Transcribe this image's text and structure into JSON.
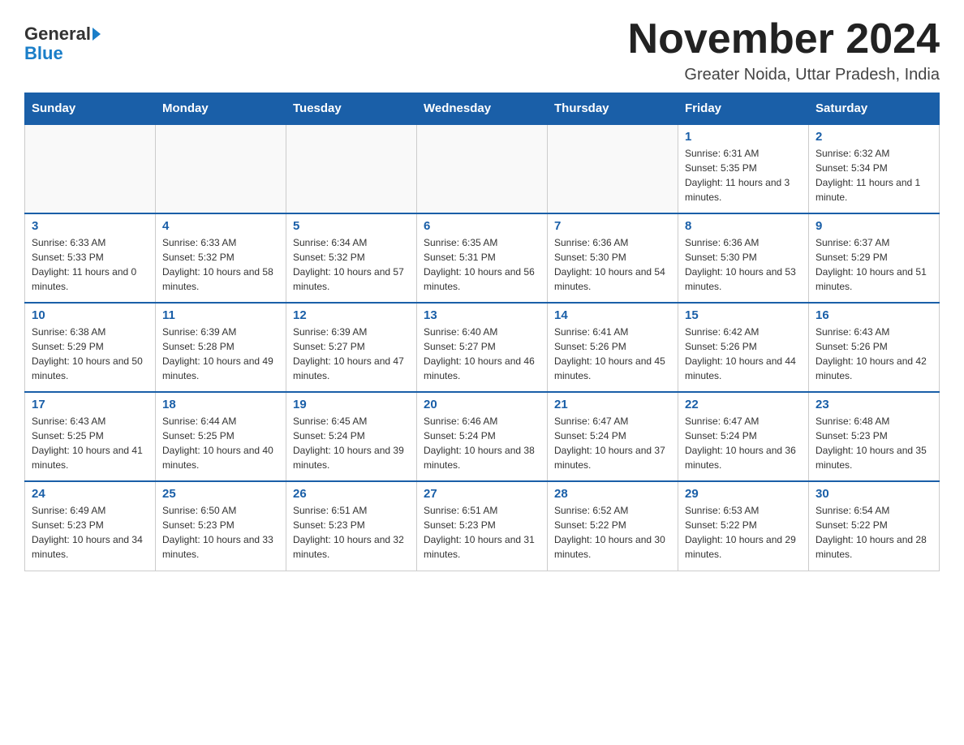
{
  "logo": {
    "general": "General",
    "blue": "Blue"
  },
  "title": "November 2024",
  "location": "Greater Noida, Uttar Pradesh, India",
  "days_of_week": [
    "Sunday",
    "Monday",
    "Tuesday",
    "Wednesday",
    "Thursday",
    "Friday",
    "Saturday"
  ],
  "weeks": [
    [
      {
        "day": "",
        "info": ""
      },
      {
        "day": "",
        "info": ""
      },
      {
        "day": "",
        "info": ""
      },
      {
        "day": "",
        "info": ""
      },
      {
        "day": "",
        "info": ""
      },
      {
        "day": "1",
        "info": "Sunrise: 6:31 AM\nSunset: 5:35 PM\nDaylight: 11 hours and 3 minutes."
      },
      {
        "day": "2",
        "info": "Sunrise: 6:32 AM\nSunset: 5:34 PM\nDaylight: 11 hours and 1 minute."
      }
    ],
    [
      {
        "day": "3",
        "info": "Sunrise: 6:33 AM\nSunset: 5:33 PM\nDaylight: 11 hours and 0 minutes."
      },
      {
        "day": "4",
        "info": "Sunrise: 6:33 AM\nSunset: 5:32 PM\nDaylight: 10 hours and 58 minutes."
      },
      {
        "day": "5",
        "info": "Sunrise: 6:34 AM\nSunset: 5:32 PM\nDaylight: 10 hours and 57 minutes."
      },
      {
        "day": "6",
        "info": "Sunrise: 6:35 AM\nSunset: 5:31 PM\nDaylight: 10 hours and 56 minutes."
      },
      {
        "day": "7",
        "info": "Sunrise: 6:36 AM\nSunset: 5:30 PM\nDaylight: 10 hours and 54 minutes."
      },
      {
        "day": "8",
        "info": "Sunrise: 6:36 AM\nSunset: 5:30 PM\nDaylight: 10 hours and 53 minutes."
      },
      {
        "day": "9",
        "info": "Sunrise: 6:37 AM\nSunset: 5:29 PM\nDaylight: 10 hours and 51 minutes."
      }
    ],
    [
      {
        "day": "10",
        "info": "Sunrise: 6:38 AM\nSunset: 5:29 PM\nDaylight: 10 hours and 50 minutes."
      },
      {
        "day": "11",
        "info": "Sunrise: 6:39 AM\nSunset: 5:28 PM\nDaylight: 10 hours and 49 minutes."
      },
      {
        "day": "12",
        "info": "Sunrise: 6:39 AM\nSunset: 5:27 PM\nDaylight: 10 hours and 47 minutes."
      },
      {
        "day": "13",
        "info": "Sunrise: 6:40 AM\nSunset: 5:27 PM\nDaylight: 10 hours and 46 minutes."
      },
      {
        "day": "14",
        "info": "Sunrise: 6:41 AM\nSunset: 5:26 PM\nDaylight: 10 hours and 45 minutes."
      },
      {
        "day": "15",
        "info": "Sunrise: 6:42 AM\nSunset: 5:26 PM\nDaylight: 10 hours and 44 minutes."
      },
      {
        "day": "16",
        "info": "Sunrise: 6:43 AM\nSunset: 5:26 PM\nDaylight: 10 hours and 42 minutes."
      }
    ],
    [
      {
        "day": "17",
        "info": "Sunrise: 6:43 AM\nSunset: 5:25 PM\nDaylight: 10 hours and 41 minutes."
      },
      {
        "day": "18",
        "info": "Sunrise: 6:44 AM\nSunset: 5:25 PM\nDaylight: 10 hours and 40 minutes."
      },
      {
        "day": "19",
        "info": "Sunrise: 6:45 AM\nSunset: 5:24 PM\nDaylight: 10 hours and 39 minutes."
      },
      {
        "day": "20",
        "info": "Sunrise: 6:46 AM\nSunset: 5:24 PM\nDaylight: 10 hours and 38 minutes."
      },
      {
        "day": "21",
        "info": "Sunrise: 6:47 AM\nSunset: 5:24 PM\nDaylight: 10 hours and 37 minutes."
      },
      {
        "day": "22",
        "info": "Sunrise: 6:47 AM\nSunset: 5:24 PM\nDaylight: 10 hours and 36 minutes."
      },
      {
        "day": "23",
        "info": "Sunrise: 6:48 AM\nSunset: 5:23 PM\nDaylight: 10 hours and 35 minutes."
      }
    ],
    [
      {
        "day": "24",
        "info": "Sunrise: 6:49 AM\nSunset: 5:23 PM\nDaylight: 10 hours and 34 minutes."
      },
      {
        "day": "25",
        "info": "Sunrise: 6:50 AM\nSunset: 5:23 PM\nDaylight: 10 hours and 33 minutes."
      },
      {
        "day": "26",
        "info": "Sunrise: 6:51 AM\nSunset: 5:23 PM\nDaylight: 10 hours and 32 minutes."
      },
      {
        "day": "27",
        "info": "Sunrise: 6:51 AM\nSunset: 5:23 PM\nDaylight: 10 hours and 31 minutes."
      },
      {
        "day": "28",
        "info": "Sunrise: 6:52 AM\nSunset: 5:22 PM\nDaylight: 10 hours and 30 minutes."
      },
      {
        "day": "29",
        "info": "Sunrise: 6:53 AM\nSunset: 5:22 PM\nDaylight: 10 hours and 29 minutes."
      },
      {
        "day": "30",
        "info": "Sunrise: 6:54 AM\nSunset: 5:22 PM\nDaylight: 10 hours and 28 minutes."
      }
    ]
  ]
}
